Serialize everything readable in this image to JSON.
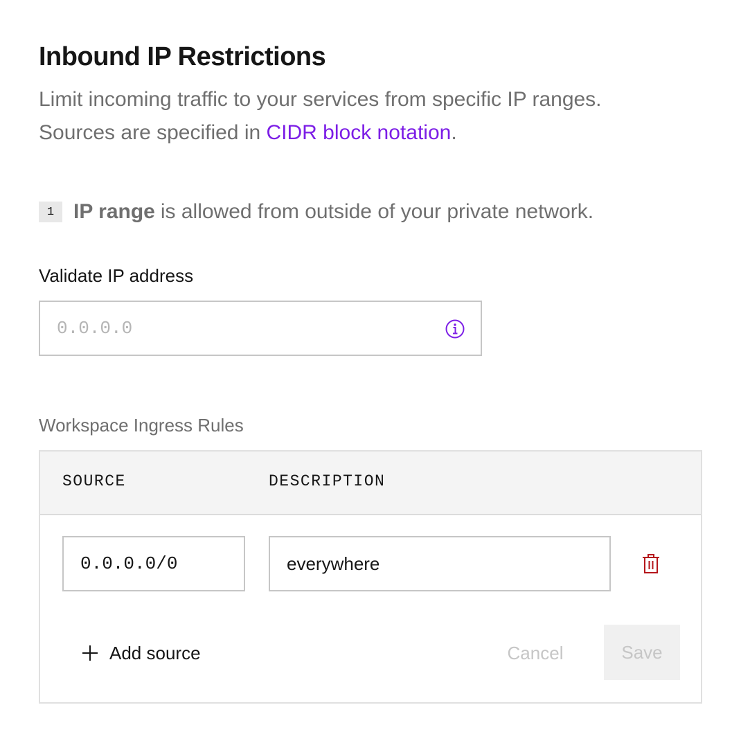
{
  "header": {
    "title": "Inbound IP Restrictions",
    "description_line1": "Limit incoming traffic to your services from specific IP ranges.",
    "description_line2_prefix": "Sources are specified in ",
    "description_link": "CIDR block notation",
    "description_line2_suffix": "."
  },
  "range_note": {
    "count": "1",
    "bold_text": "IP range",
    "text": "is allowed from outside of your private network."
  },
  "validate": {
    "label": "Validate IP address",
    "placeholder": "0.0.0.0",
    "value": "",
    "info_icon": "info-circle-icon"
  },
  "rules": {
    "label": "Workspace Ingress Rules",
    "columns": [
      "SOURCE",
      "DESCRIPTION"
    ],
    "rows": [
      {
        "source": "0.0.0.0/0",
        "description": "everywhere",
        "delete_icon": "trash-icon"
      }
    ],
    "add_source_label": "Add source",
    "add_icon": "plus-icon",
    "cancel_label": "Cancel",
    "save_label": "Save"
  },
  "colors": {
    "accent": "#7c1ee6",
    "danger": "#b5161b",
    "text": "#161616",
    "muted_text": "#6f6f6f",
    "border": "#c6c6c6",
    "header_bg": "#f4f4f4",
    "disabled_text": "#c6c6c6",
    "disabled_bg": "#f0f0f0"
  }
}
